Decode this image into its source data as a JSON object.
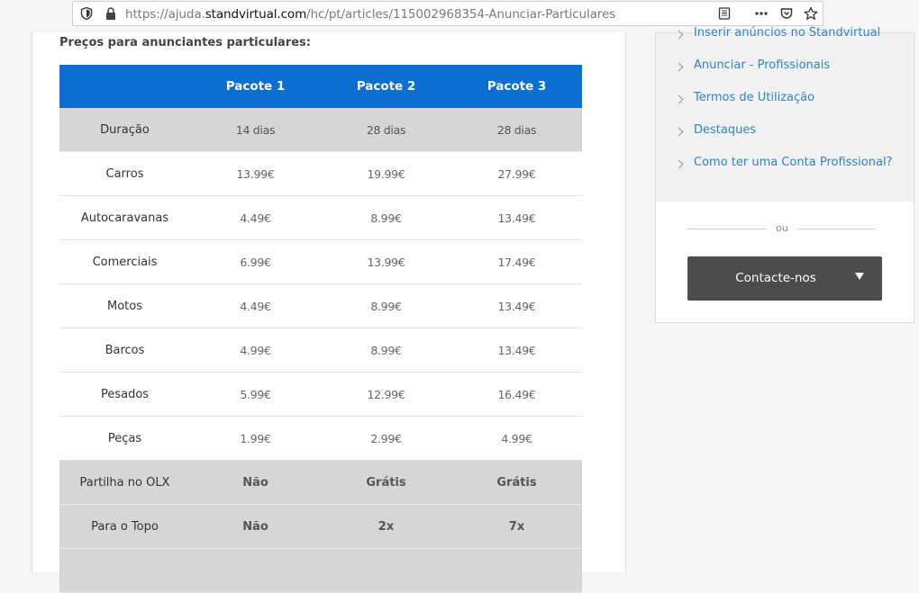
{
  "browser": {
    "url_prefix": "https://ajuda.",
    "url_domain": "standvirtual.com",
    "url_path": "/hc/pt/articles/115002968354-Anunciar-Particulares"
  },
  "article": {
    "heading": "Preços para anunciantes particulares:"
  },
  "pricing": {
    "headers": [
      "",
      "Pacote 1",
      "Pacote 2",
      "Pacote 3"
    ],
    "rows": [
      {
        "label": "Duração",
        "values": [
          "14 dias",
          "28 dias",
          "28 dias"
        ]
      },
      {
        "label": "Carros",
        "values": [
          "13.99€",
          "19.99€",
          "27.99€"
        ]
      },
      {
        "label": "Autocaravanas",
        "values": [
          "4.49€",
          "8.99€",
          "13.49€"
        ]
      },
      {
        "label": "Comerciais",
        "values": [
          "6.99€",
          "13.99€",
          "17.49€"
        ]
      },
      {
        "label": "Motos",
        "values": [
          "4.49€",
          "8.99€",
          "13.49€"
        ]
      },
      {
        "label": "Barcos",
        "values": [
          "4.99€",
          "8.99€",
          "13.49€"
        ]
      },
      {
        "label": "Pesados",
        "values": [
          "5.99€",
          "12.99€",
          "16.49€"
        ]
      },
      {
        "label": "Peças",
        "values": [
          "1.99€",
          "2.99€",
          "4.99€"
        ]
      },
      {
        "label": "Partilha no OLX",
        "values": [
          "Não",
          "Grátis",
          "Grátis"
        ]
      },
      {
        "label": "Para o Topo",
        "values": [
          "Não",
          "2x",
          "7x"
        ]
      }
    ]
  },
  "sidebar": {
    "links": [
      "Inserir anúncios no Standvirtual",
      "Anunciar - Profissionais",
      "Termos de Utilização",
      "Destaques",
      "Como ter uma Conta Profissional?"
    ],
    "divider_text": "ou",
    "contact_button": "Contacte-nos"
  },
  "icons": [
    "shield-icon",
    "lock-icon",
    "reader-view-icon",
    "more-icon",
    "pocket-icon",
    "bookmark-star-icon",
    "chevron-right-icon",
    "caret-down-icon"
  ]
}
